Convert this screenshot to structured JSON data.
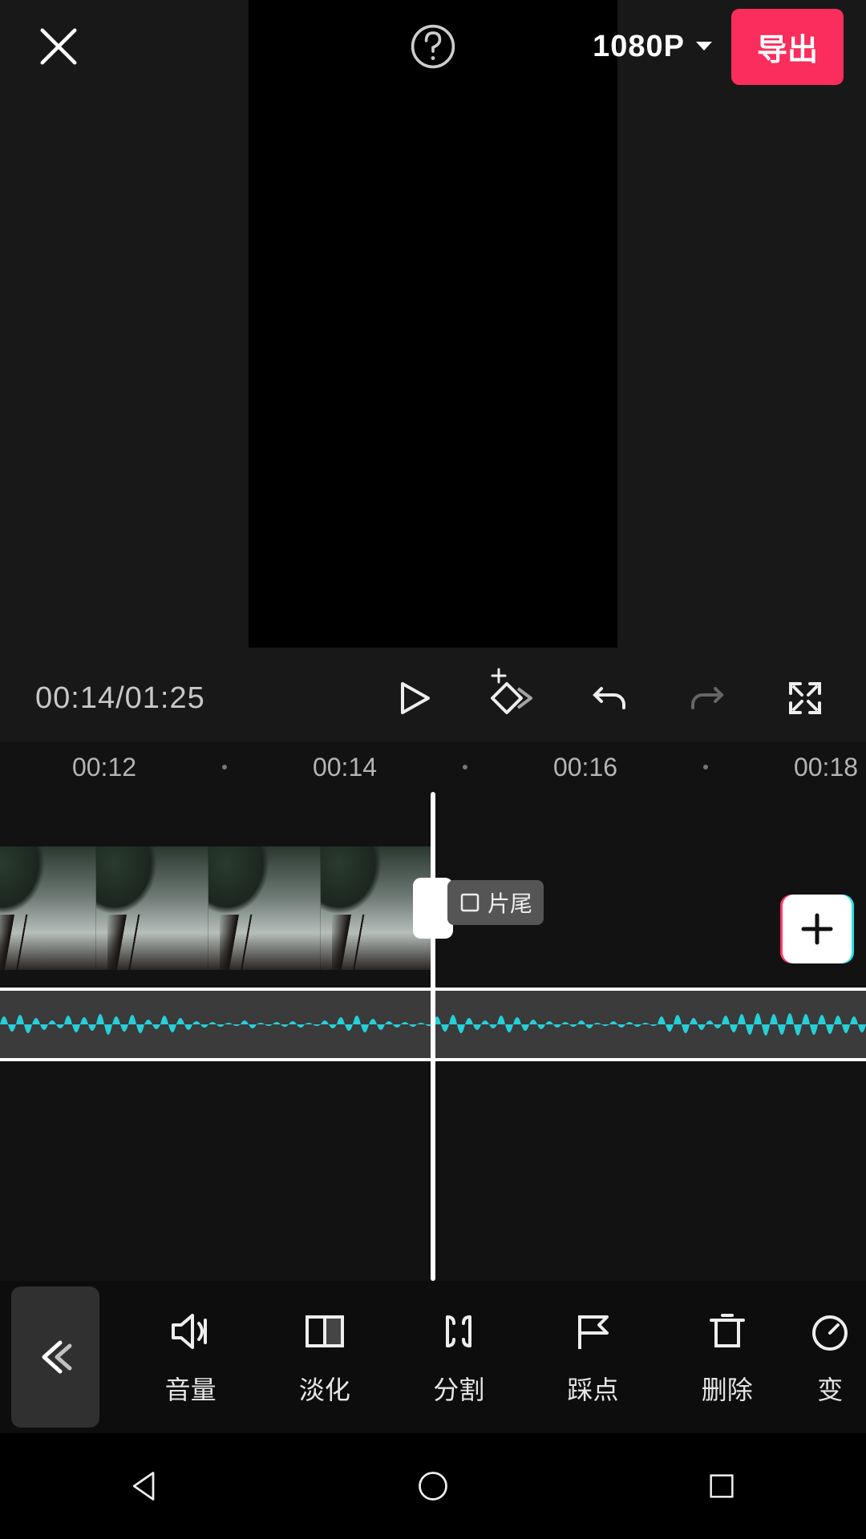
{
  "topbar": {
    "resolution_label": "1080P",
    "export_label": "导出"
  },
  "transport": {
    "current_time": "00:14",
    "total_time": "01:25"
  },
  "ruler": {
    "ticks": [
      "00:12",
      "00:14",
      "00:16",
      "00:18"
    ]
  },
  "timeline": {
    "end_tag_label": "片尾"
  },
  "toolbar": {
    "tools": [
      {
        "id": "volume",
        "label": "音量"
      },
      {
        "id": "fade",
        "label": "淡化"
      },
      {
        "id": "split",
        "label": "分割"
      },
      {
        "id": "beat",
        "label": "踩点"
      },
      {
        "id": "delete",
        "label": "删除"
      },
      {
        "id": "speed",
        "label": "变"
      }
    ]
  },
  "colors": {
    "accent": "#fa2d5c",
    "wave": "#25d0d8"
  }
}
